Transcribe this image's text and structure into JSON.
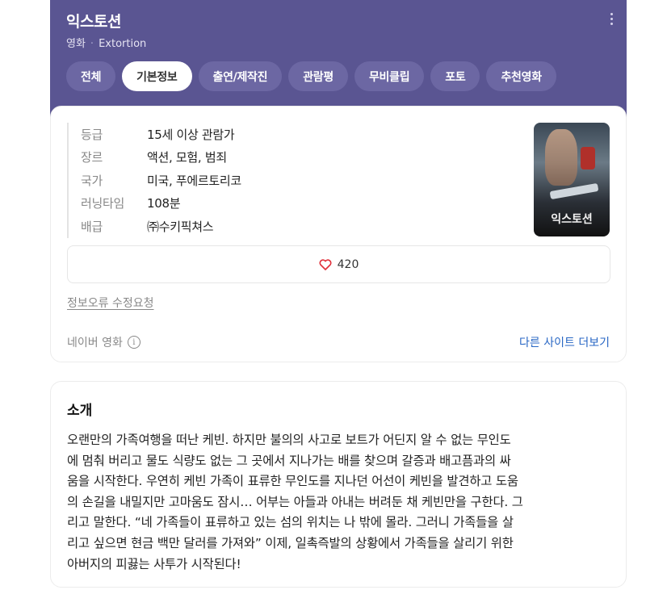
{
  "header": {
    "title": "익스토션",
    "category": "영화",
    "english_title": "Extortion",
    "tabs": [
      "전체",
      "기본정보",
      "출연/제작진",
      "관람평",
      "무비클립",
      "포토",
      "추천영화"
    ],
    "active_tab": "기본정보"
  },
  "info": {
    "rows": [
      {
        "k": "등급",
        "v": "15세 이상 관람가"
      },
      {
        "k": "장르",
        "v": "액션, 모험, 범죄"
      },
      {
        "k": "국가",
        "v": "미국, 푸에르토리코"
      },
      {
        "k": "러닝타임",
        "v": "108분"
      },
      {
        "k": "배급",
        "v": "㈜수키픽쳐스"
      }
    ],
    "poster_title": "익스토션",
    "likes": "420",
    "report_link": "정보오류 수정요청",
    "source": "네이버 영화",
    "more_sites": "다른 사이트 더보기"
  },
  "intro": {
    "heading": "소개",
    "lines": [
      "오랜만의 가족여행을 떠난 케빈. 하지만 불의의 사고로 보트가 어딘지 알 수 없는 무인도",
      "에 멈춰 버리고 물도 식량도 없는 그 곳에서 지나가는 배를 찾으며 갈증과 배고픔과의 싸",
      "움을 시작한다. 우연히 케빈 가족이 표류한 무인도를 지나던 어선이 케빈을 발견하고 도움",
      "의 손길을 내밀지만 고마움도 잠시… 어부는 아들과 아내는 버려둔 채 케빈만을 구한다. 그",
      "리고 말한다. “네 가족들이 표류하고 있는 섬의 위치는 나 밖에 몰라. 그러니 가족들을 살",
      "리고 싶으면 현금 백만 달러를 가져와” 이제, 일촉즉발의 상황에서 가족들을 살리기 위한",
      "아버지의 피끓는 사투가 시작된다!"
    ]
  },
  "colors": {
    "header_bg": "#5a5592",
    "tab_bg": "#6c67a3",
    "link": "#2766c4",
    "heart": "#e0303a"
  }
}
